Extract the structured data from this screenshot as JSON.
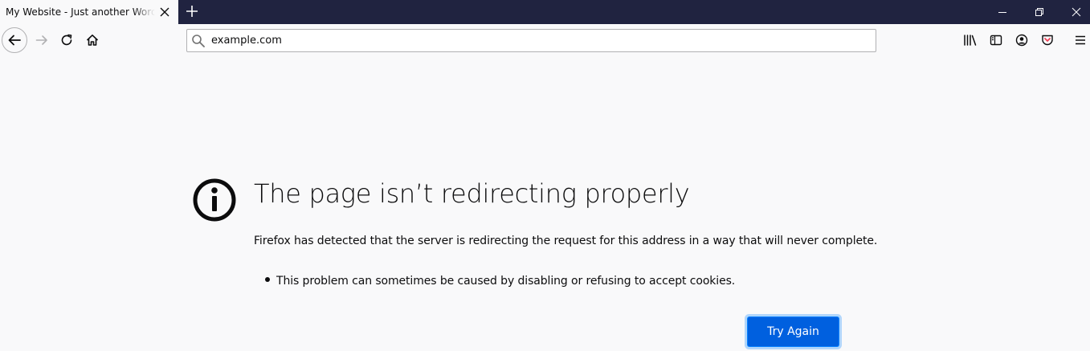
{
  "tab": {
    "title": "My Website - Just another WordPress site",
    "close_icon": "close-icon"
  },
  "toolbar": {
    "new_tab_icon": "plus-icon",
    "back_icon": "arrow-left-icon",
    "forward_icon": "arrow-right-icon",
    "reload_icon": "reload-icon",
    "home_icon": "home-icon",
    "library_icon": "library-icon",
    "sidebar_icon": "sidebar-icon",
    "account_icon": "account-icon",
    "pocket_icon": "pocket-icon",
    "menu_icon": "hamburger-icon"
  },
  "urlbar": {
    "value": "example.com",
    "search_icon": "search-icon"
  },
  "window_controls": {
    "minimize_icon": "minimize-icon",
    "restore_icon": "restore-icon",
    "close_icon": "close-icon"
  },
  "error": {
    "title": "The page isn’t redirecting properly",
    "description": "Firefox has detected that the server is redirecting the request for this address in a way that will never complete.",
    "hints": [
      "This problem can sometimes be caused by disabling or refusing to accept cookies."
    ],
    "button_label": "Try Again",
    "icon": "info-icon"
  },
  "colors": {
    "tabbar": "#202340",
    "page_bg": "#f9f9fa",
    "button": "#0060df",
    "text": "#0c0c0d",
    "pocket": "#ef4056"
  }
}
